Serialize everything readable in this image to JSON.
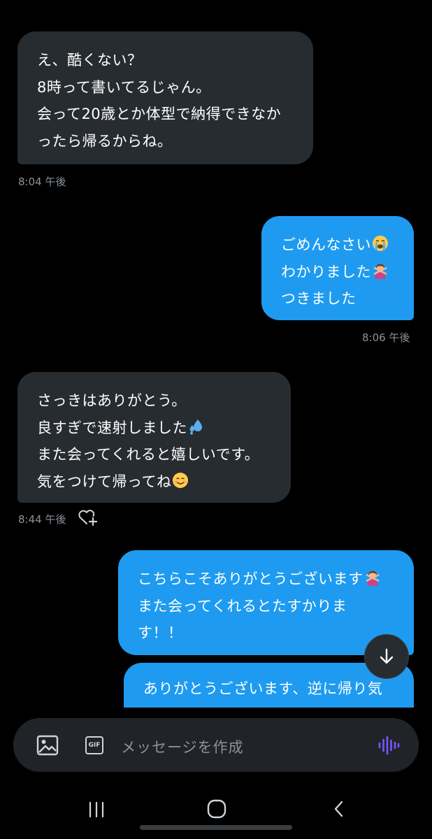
{
  "messages": [
    {
      "direction": "incoming",
      "lines": [
        "え、酷くない？",
        "8時って書いてるじゃん。",
        "会って20歳とか体型で納得できなか",
        "ったら帰るからね。"
      ],
      "time": "8:04 午後"
    },
    {
      "direction": "outgoing",
      "lines": [
        "ごめんなさい",
        "わかりました",
        "つきました"
      ],
      "emojis": [
        "loudly-crying-face-emoji",
        "person-gesturing-no-emoji"
      ],
      "time": "8:06 午後"
    },
    {
      "direction": "incoming",
      "lines": [
        "さっきはありがとう。",
        "良すぎで速射しました",
        "また会ってくれると嬉しいです。",
        "気をつけて帰ってね"
      ],
      "emojis": [
        "sweat-droplets-emoji",
        "smiling-face-emoji"
      ],
      "time": "8:44 午後",
      "reaction_icon": "heart-plus-icon"
    },
    {
      "direction": "outgoing",
      "lines": [
        "こちらこそありがとうございます",
        "また会ってくれるとたすかりま",
        "す！！"
      ],
      "emojis": [
        "person-gesturing-no-emoji"
      ]
    },
    {
      "direction": "outgoing",
      "lines": [
        "ありがとうございます、逆に帰り気"
      ],
      "partially_visible": true
    }
  ],
  "composer": {
    "placeholder": "メッセージを作成",
    "image_button_icon": "image-icon",
    "gif_button_label": "GIF",
    "voice_button_icon": "voice-waveform-icon"
  },
  "scroll_button_icon": "arrow-down-icon",
  "system_nav": {
    "icons": [
      "recent-apps-icon",
      "home-icon",
      "back-icon"
    ]
  },
  "colors": {
    "background": "#000000",
    "incoming_bubble": "#272c31",
    "outgoing_bubble": "#1e9bf0",
    "timestamp": "#8b9299",
    "voice_accent": "#7856ff"
  }
}
